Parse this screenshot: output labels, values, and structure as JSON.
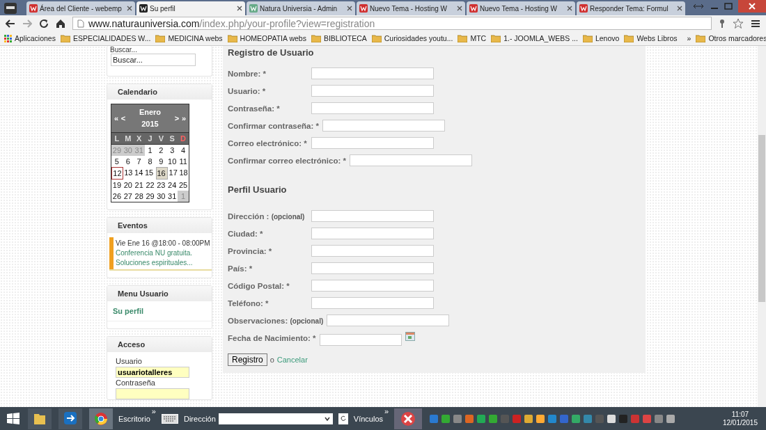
{
  "browser": {
    "tabs": [
      {
        "title": "Área del Cliente - webemp",
        "selected": false
      },
      {
        "title": "Su perfil",
        "selected": true
      },
      {
        "title": "Natura Universia - Admin",
        "selected": false
      },
      {
        "title": "Nuevo Tema - Hosting W",
        "selected": false
      },
      {
        "title": "Nuevo Tema - Hosting W",
        "selected": false
      },
      {
        "title": "Responder Tema: Formul",
        "selected": false
      }
    ],
    "url": {
      "host": "www.naturauniversia.com",
      "path": "/index.php/your-profile?view=registration"
    },
    "bookmarks": [
      {
        "label": "Aplicaciones",
        "kind": "apps"
      },
      {
        "label": "ESPECIALIDADES W...",
        "kind": "folder"
      },
      {
        "label": "MEDICINA webs",
        "kind": "folder"
      },
      {
        "label": "HOMEOPATIA webs",
        "kind": "folder"
      },
      {
        "label": "BIBLIOTECA",
        "kind": "folder"
      },
      {
        "label": "Curiosidades youtu...",
        "kind": "folder"
      },
      {
        "label": "MTC",
        "kind": "folder"
      },
      {
        "label": "1.- JOOMLA_WEBS ...",
        "kind": "folder"
      },
      {
        "label": "Lenovo",
        "kind": "folder"
      },
      {
        "label": "Webs Libros",
        "kind": "folder"
      }
    ],
    "more": "»",
    "other": "Otros marcadores"
  },
  "sidebar": {
    "search": {
      "label": "Buscar...",
      "placeholder": "Buscar..."
    },
    "calendar": {
      "title": "Calendario",
      "prev_year": "«",
      "prev": "<",
      "month": "Enero",
      "year": "2015",
      "next": ">",
      "next_year": "»",
      "weekdays": [
        {
          "d": "L",
          "sunday": false
        },
        {
          "d": "M",
          "sunday": false
        },
        {
          "d": "X",
          "sunday": false
        },
        {
          "d": "J",
          "sunday": false
        },
        {
          "d": "V",
          "sunday": false
        },
        {
          "d": "S",
          "sunday": false
        },
        {
          "d": "D",
          "sunday": true
        }
      ],
      "weeks": [
        [
          {
            "d": "29",
            "kind": "other"
          },
          {
            "d": "30",
            "kind": "other"
          },
          {
            "d": "31",
            "kind": "other"
          },
          {
            "d": "1",
            "kind": "day"
          },
          {
            "d": "2",
            "kind": "day"
          },
          {
            "d": "3",
            "kind": "day"
          },
          {
            "d": "4",
            "kind": "day"
          }
        ],
        [
          {
            "d": "5",
            "kind": "day"
          },
          {
            "d": "6",
            "kind": "day"
          },
          {
            "d": "7",
            "kind": "day"
          },
          {
            "d": "8",
            "kind": "day"
          },
          {
            "d": "9",
            "kind": "day"
          },
          {
            "d": "10",
            "kind": "day"
          },
          {
            "d": "11",
            "kind": "day"
          }
        ],
        [
          {
            "d": "12",
            "kind": "today"
          },
          {
            "d": "13",
            "kind": "day"
          },
          {
            "d": "14",
            "kind": "day"
          },
          {
            "d": "15",
            "kind": "day"
          },
          {
            "d": "16",
            "kind": "event"
          },
          {
            "d": "17",
            "kind": "day"
          },
          {
            "d": "18",
            "kind": "day"
          }
        ],
        [
          {
            "d": "19",
            "kind": "day"
          },
          {
            "d": "20",
            "kind": "day"
          },
          {
            "d": "21",
            "kind": "day"
          },
          {
            "d": "22",
            "kind": "day"
          },
          {
            "d": "23",
            "kind": "day"
          },
          {
            "d": "24",
            "kind": "day"
          },
          {
            "d": "25",
            "kind": "day"
          }
        ],
        [
          {
            "d": "26",
            "kind": "day"
          },
          {
            "d": "27",
            "kind": "day"
          },
          {
            "d": "28",
            "kind": "day"
          },
          {
            "d": "29",
            "kind": "day"
          },
          {
            "d": "30",
            "kind": "day"
          },
          {
            "d": "31",
            "kind": "day"
          },
          {
            "d": "1",
            "kind": "other"
          }
        ]
      ]
    },
    "events": {
      "title": "Eventos",
      "items": [
        {
          "when": "Vie Ene 16 @18:00 - 08:00PM",
          "title": "Conferencia NU gratuita.",
          "subtitle": "Soluciones espirituales...",
          "color": "#f0a020"
        }
      ]
    },
    "menu": {
      "title": "Menu Usuario",
      "items": [
        "Su perfil"
      ]
    },
    "login": {
      "title": "Acceso",
      "user_label": "Usuario",
      "user_value": "usuariotalleres",
      "password_label": "Contraseña"
    }
  },
  "form": {
    "title": "Registro de Usuario",
    "account": [
      {
        "label": "Nombre: *"
      },
      {
        "label": "Usuario: *"
      },
      {
        "label": "Contraseña: *"
      },
      {
        "label": "Confirmar contraseña: *"
      },
      {
        "label": "Correo electrónico: *"
      },
      {
        "label": "Confirmar correo electrónico: *"
      }
    ],
    "profile_title": "Perfil Usuario",
    "profile": [
      {
        "label": "Dirección :",
        "note": "(opcional)",
        "kind": "text"
      },
      {
        "label": "Ciudad: *",
        "kind": "text"
      },
      {
        "label": "Provincia: *",
        "kind": "text"
      },
      {
        "label": "País: *",
        "kind": "text"
      },
      {
        "label": "Código Postal: *",
        "kind": "text"
      },
      {
        "label": "Teléfono: *",
        "kind": "text"
      },
      {
        "label": "Observaciones:",
        "note": "(opcional)",
        "kind": "text"
      },
      {
        "label": "Fecha de Nacimiento: *",
        "kind": "date"
      }
    ],
    "submit": "Registro",
    "or": "o",
    "cancel": "Cancelar"
  },
  "taskbar": {
    "toolbar_label": "Escritorio",
    "toolbar_more": "»",
    "address_label": "Dirección",
    "links_label": "Vínculos",
    "links_more": "»",
    "time": "11:07",
    "date": "12/01/2015"
  }
}
